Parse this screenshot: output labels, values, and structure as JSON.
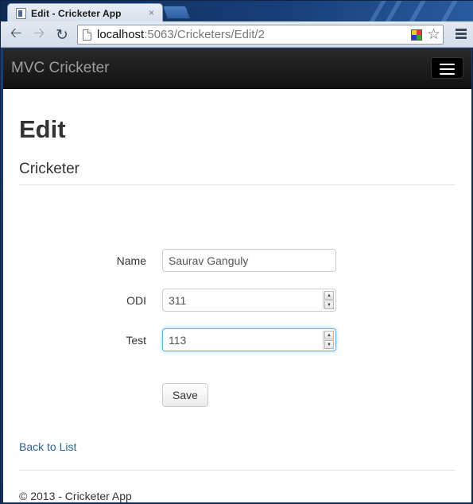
{
  "browser": {
    "tab_title": "Edit - Cricketer App",
    "tab_close": "×",
    "url_host": "localhost",
    "url_path": ":5063/Cricketers/Edit/2"
  },
  "app": {
    "brand": "MVC Cricketer"
  },
  "page": {
    "heading": "Edit",
    "subheading": "Cricketer",
    "fields": {
      "name": {
        "label": "Name",
        "value": "Saurav Ganguly"
      },
      "odi": {
        "label": "ODI",
        "value": "311"
      },
      "test": {
        "label": "Test",
        "value": "113"
      }
    },
    "save_label": "Save",
    "back_link": "Back to List",
    "footer": "© 2013 - Cricketer App"
  },
  "icons": {
    "back": "back-arrow-icon",
    "forward": "forward-arrow-icon",
    "reload": "reload-icon",
    "star": "star-icon",
    "menu": "menu-icon",
    "hamburger": "hamburger-icon"
  },
  "colors": {
    "navbar": "#222222",
    "link": "#2a6496",
    "focus": "#66afe9"
  }
}
